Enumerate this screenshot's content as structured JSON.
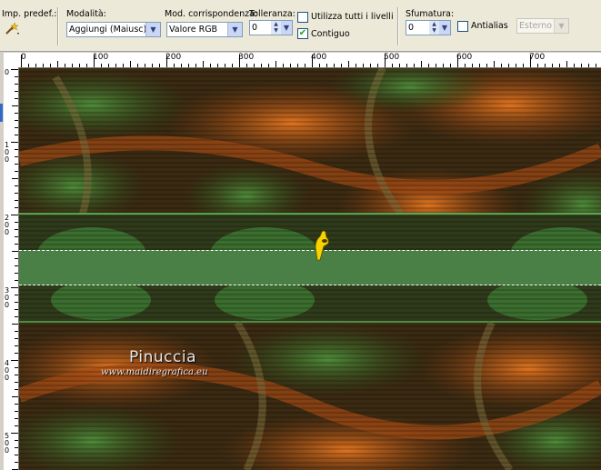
{
  "toolbar": {
    "preset_label": "Imp. predef.:",
    "mode": {
      "label": "Modalità:",
      "value": "Aggiungi (Maiusc)"
    },
    "match_mode": {
      "label": "Mod. corrispondenza:",
      "value": "Valore RGB"
    },
    "tolerance": {
      "label": "Tolleranza:",
      "value": "0"
    },
    "use_all_layers": {
      "label": "Utilizza tutti i livelli",
      "checked": false
    },
    "contiguous": {
      "label": "Contiguo",
      "checked": true
    },
    "feather": {
      "label": "Sfumatura:",
      "value": "0"
    },
    "antialias": {
      "label": "Antialias",
      "checked": false
    },
    "antialias_mode": {
      "value": "Esterno",
      "disabled": true
    }
  },
  "ruler": {
    "top_labels": [
      "0",
      "100",
      "200",
      "300",
      "400",
      "500",
      "600",
      "700"
    ],
    "left_labels": [
      "0",
      "100",
      "200",
      "300",
      "400",
      "500"
    ]
  },
  "watermark": {
    "name": "Pinuccia",
    "url": "www.maidiregrafica.eu"
  },
  "colors": {
    "selection_fill": "#4a7f45",
    "ui_face": "#ece9d8",
    "accent_dark_orange": "#c4541c",
    "accent_dark_green": "#3a5a22"
  },
  "icons": [
    "magic-wand-icon",
    "hand-pointer-icon"
  ]
}
